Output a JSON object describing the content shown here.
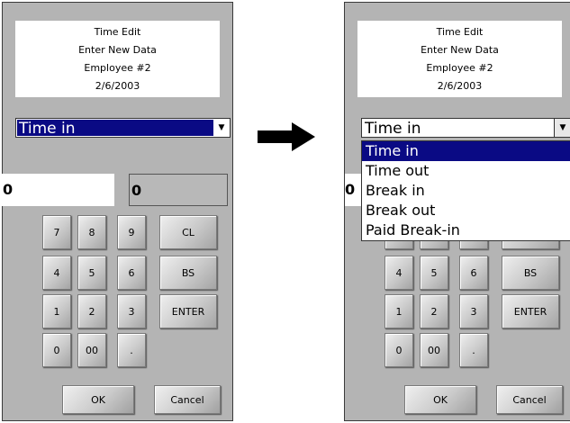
{
  "header": {
    "title": "Time Edit",
    "subtitle": "Enter New Data",
    "employee": "Employee #2",
    "date": "2/6/2003"
  },
  "dropdown": {
    "selected": "Time in",
    "options": [
      "Time in",
      "Time out",
      "Break in",
      "Break out",
      "Paid Break-in"
    ]
  },
  "fields": {
    "input_value": "0",
    "display_value": "0"
  },
  "keypad": {
    "k7": "7",
    "k8": "8",
    "k9": "9",
    "clear": "CL",
    "k4": "4",
    "k5": "5",
    "k6": "6",
    "backspace": "BS",
    "k1": "1",
    "k2": "2",
    "k3": "3",
    "enter": "ENTER",
    "k0": "0",
    "k00": "00",
    "dot": "."
  },
  "buttons": {
    "ok": "OK",
    "cancel": "Cancel"
  },
  "icons": {
    "transition_arrow": "right-arrow-icon",
    "dropdown_arrow": "chevron-down-icon"
  },
  "colors": {
    "panel_bg": "#b4b4b4",
    "selection_bg": "#0a0a84"
  }
}
